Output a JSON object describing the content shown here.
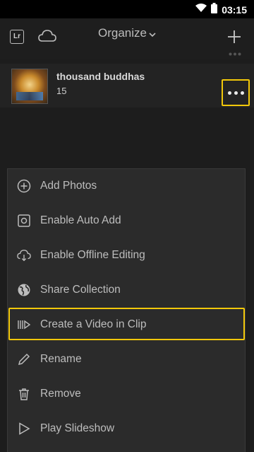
{
  "status_bar": {
    "time": "03:15",
    "icons": [
      "wifi-icon",
      "battery-icon"
    ]
  },
  "app_bar": {
    "logo": "Lr",
    "title": "Organize",
    "icons": [
      "cloud-icon",
      "chevron-down-icon",
      "plus-icon"
    ]
  },
  "album": {
    "title": "thousand buddhas",
    "count": "15"
  },
  "menu": {
    "items": [
      {
        "label": "Add Photos",
        "icon": "plus-circle-icon"
      },
      {
        "label": "Enable Auto Add",
        "icon": "auto-add-icon"
      },
      {
        "label": "Enable Offline Editing",
        "icon": "cloud-download-icon"
      },
      {
        "label": "Share Collection",
        "icon": "globe-icon"
      },
      {
        "label": "Create a Video in Clip",
        "icon": "video-clip-icon"
      },
      {
        "label": "Rename",
        "icon": "pencil-icon"
      },
      {
        "label": "Remove",
        "icon": "trash-icon"
      },
      {
        "label": "Play Slideshow",
        "icon": "play-icon"
      }
    ]
  },
  "colors": {
    "highlight": "#f2c80a",
    "menu_bg": "#2b2b2b",
    "background": "#1d1d1d"
  }
}
